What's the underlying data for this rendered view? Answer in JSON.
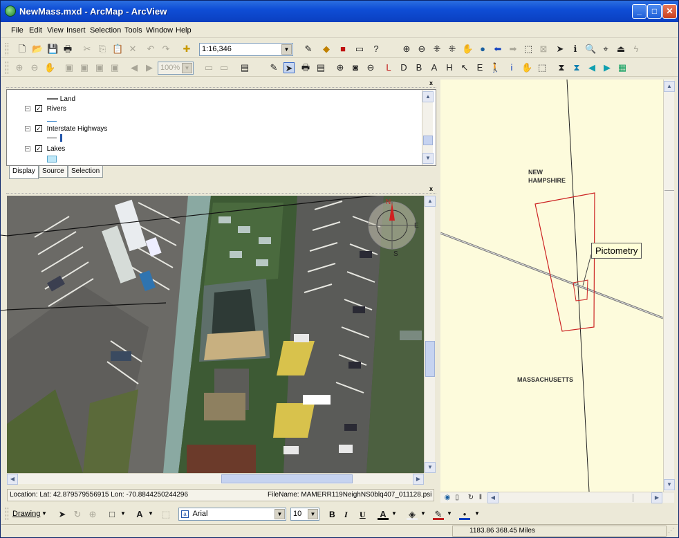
{
  "window": {
    "title": "NewMass.mxd - ArcMap - ArcView"
  },
  "menu": [
    "File",
    "Edit",
    "View",
    "Insert",
    "Selection",
    "Tools",
    "Window",
    "Help"
  ],
  "toolbar": {
    "scale_value": "1:16,346",
    "zoom_value": "100%"
  },
  "toc": {
    "layers": [
      {
        "label": "Land",
        "type": "legend"
      },
      {
        "label": "Rivers",
        "checked": true
      },
      {
        "label": "Interstate Highways",
        "checked": true
      },
      {
        "label": "Lakes",
        "checked": true
      }
    ],
    "tabs": [
      "Display",
      "Source",
      "Selection"
    ]
  },
  "photo": {
    "location_text": "Location: Lat: 42.879579556915 Lon: -70.8844250244296",
    "filename_text": "FileName: MAMERR119NeighNS0blq407_011128.psi",
    "compass": {
      "north": "N",
      "east": "E",
      "south": "S"
    }
  },
  "map": {
    "labels": {
      "state_north": "NEW\nHAMPSHIRE",
      "state_south": "MASSACHUSETTS"
    },
    "callout": "Pictometry"
  },
  "drawing": {
    "drawing_label": "Drawing",
    "font_name": "Arial",
    "font_size": "10",
    "bold": "B",
    "italic": "I",
    "underline": "U"
  },
  "status": {
    "coords": "1183.86  368.45 Miles"
  },
  "colors": {
    "title_bar": "#0a3fc0",
    "map_bg": "#fdfbdc",
    "boundary_red": "#cc2222"
  }
}
